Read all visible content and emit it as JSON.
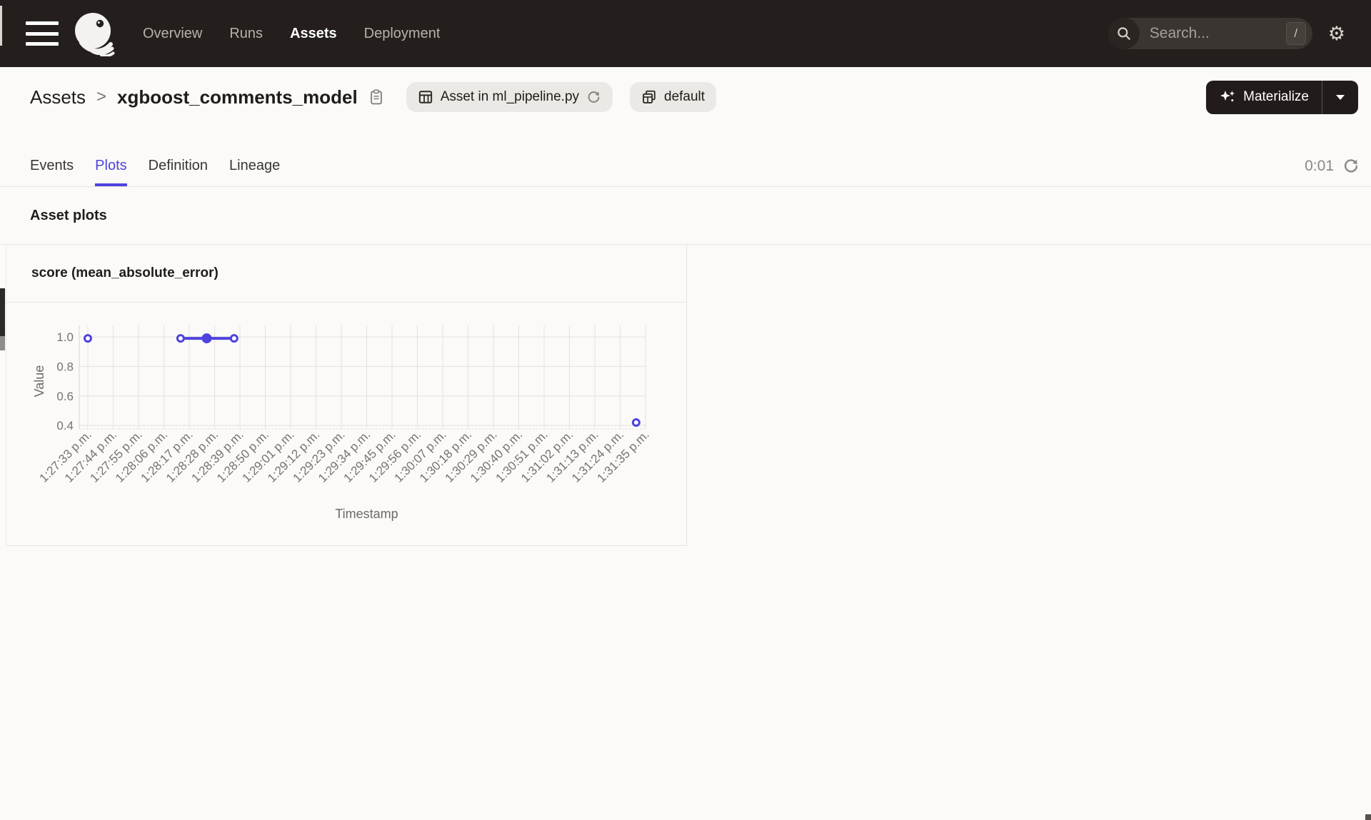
{
  "nav": {
    "menu_icon": "hamburger-menu-icon",
    "logo_icon": "dagster-logo",
    "items": [
      {
        "label": "Overview",
        "active": false
      },
      {
        "label": "Runs",
        "active": false
      },
      {
        "label": "Assets",
        "active": true
      },
      {
        "label": "Deployment",
        "active": false
      }
    ],
    "search": {
      "placeholder": "Search...",
      "shortcut": "/",
      "icon": "search-icon"
    },
    "settings_icon": "gear-icon",
    "settings_glyph": "⚙"
  },
  "header": {
    "breadcrumb_root": "Assets",
    "breadcrumb_separator": ">",
    "title": "xgboost_comments_model",
    "copy_icon": "clipboard-copy-icon",
    "badges": [
      {
        "icon": "table-icon",
        "label": "Asset in ml_pipeline.py",
        "trailing_icon": "reload-icon"
      },
      {
        "icon": "table-stack-icon",
        "label": "default"
      }
    ],
    "materialize": {
      "icon": "sparkles-icon",
      "label": "Materialize",
      "caret_icon": "caret-down-icon"
    }
  },
  "tabs": {
    "items": [
      {
        "label": "Events",
        "active": false
      },
      {
        "label": "Plots",
        "active": true
      },
      {
        "label": "Definition",
        "active": false
      },
      {
        "label": "Lineage",
        "active": false
      }
    ],
    "timer": "0:01",
    "refresh_icon": "reload-icon"
  },
  "section_title": "Asset plots",
  "chart_data": {
    "type": "line",
    "title": "score (mean_absolute_error)",
    "xlabel": "Timestamp",
    "ylabel": "Value",
    "x_ticks": [
      "1:27:33 p.m.",
      "1:27:44 p.m.",
      "1:27:55 p.m.",
      "1:28:06 p.m.",
      "1:28:17 p.m.",
      "1:28:28 p.m.",
      "1:28:39 p.m.",
      "1:28:50 p.m.",
      "1:29:01 p.m.",
      "1:29:12 p.m.",
      "1:29:23 p.m.",
      "1:29:34 p.m.",
      "1:29:45 p.m.",
      "1:29:56 p.m.",
      "1:30:07 p.m.",
      "1:30:18 p.m.",
      "1:30:29 p.m.",
      "1:30:40 p.m.",
      "1:30:51 p.m.",
      "1:31:02 p.m.",
      "1:31:13 p.m.",
      "1:31:24 p.m.",
      "1:31:35 p.m."
    ],
    "y_ticks": [
      {
        "label": "1.0",
        "value": 1.0
      },
      {
        "label": "0.8",
        "value": 0.8
      },
      {
        "label": "0.6",
        "value": 0.6
      },
      {
        "label": "0.4",
        "value": 0.4
      }
    ],
    "ylim": [
      0.37,
      1.08
    ],
    "grid": true,
    "legend": "none",
    "line_color": "#4F43DD",
    "series": [
      {
        "name": "score (mean_absolute_error)",
        "points": [
          {
            "x_index": 0,
            "y": 0.99,
            "marker": "open"
          },
          {
            "x_index": 3.66,
            "y": 0.99,
            "marker": "open"
          },
          {
            "x_index": 4.69,
            "y": 0.99,
            "marker": "filled"
          },
          {
            "x_index": 5.77,
            "y": 0.99,
            "marker": "open"
          },
          {
            "x_index": 21.63,
            "y": 0.42,
            "marker": "open"
          }
        ],
        "connected_runs": [
          [
            1,
            2,
            3
          ]
        ]
      }
    ]
  },
  "colors": {
    "accent": "#4F43DD",
    "nav_bg": "#241F1D",
    "page_bg": "#FBFAF8",
    "materialize_bg": "#211C19",
    "grid_line": "#E5E2DF",
    "axis_text": "#77726C",
    "muted_text": "#8C8781"
  }
}
